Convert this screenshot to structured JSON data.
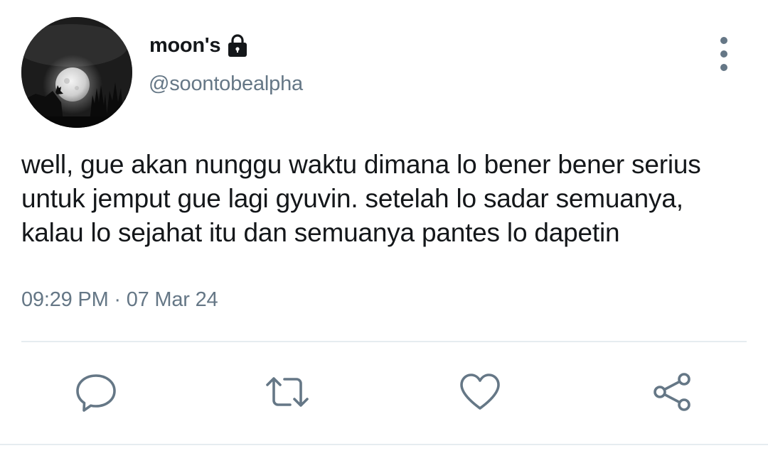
{
  "tweet": {
    "display_name": "moon's",
    "handle": "@soontobealpha",
    "protected_icon": "lock-icon",
    "avatar": "profile-photo-full-moon-wolf",
    "text_lines": [
      "well, gue akan nunggu waktu dimana lo bener bener serius",
      "untuk jemput gue lagi gyuvin. setelah lo sadar semuanya,",
      "kalau lo sejahat itu dan semuanya pantes lo dapetin"
    ],
    "timestamp": "09:29 PM · 07 Mar 24"
  },
  "actions": {
    "reply": "reply-icon",
    "retweet": "retweet-icon",
    "like": "heart-icon",
    "share": "share-icon",
    "more": "more-vertical-icon"
  },
  "colors": {
    "text": "#14171a",
    "secondary": "#657786",
    "divider": "#e6ecf0"
  }
}
